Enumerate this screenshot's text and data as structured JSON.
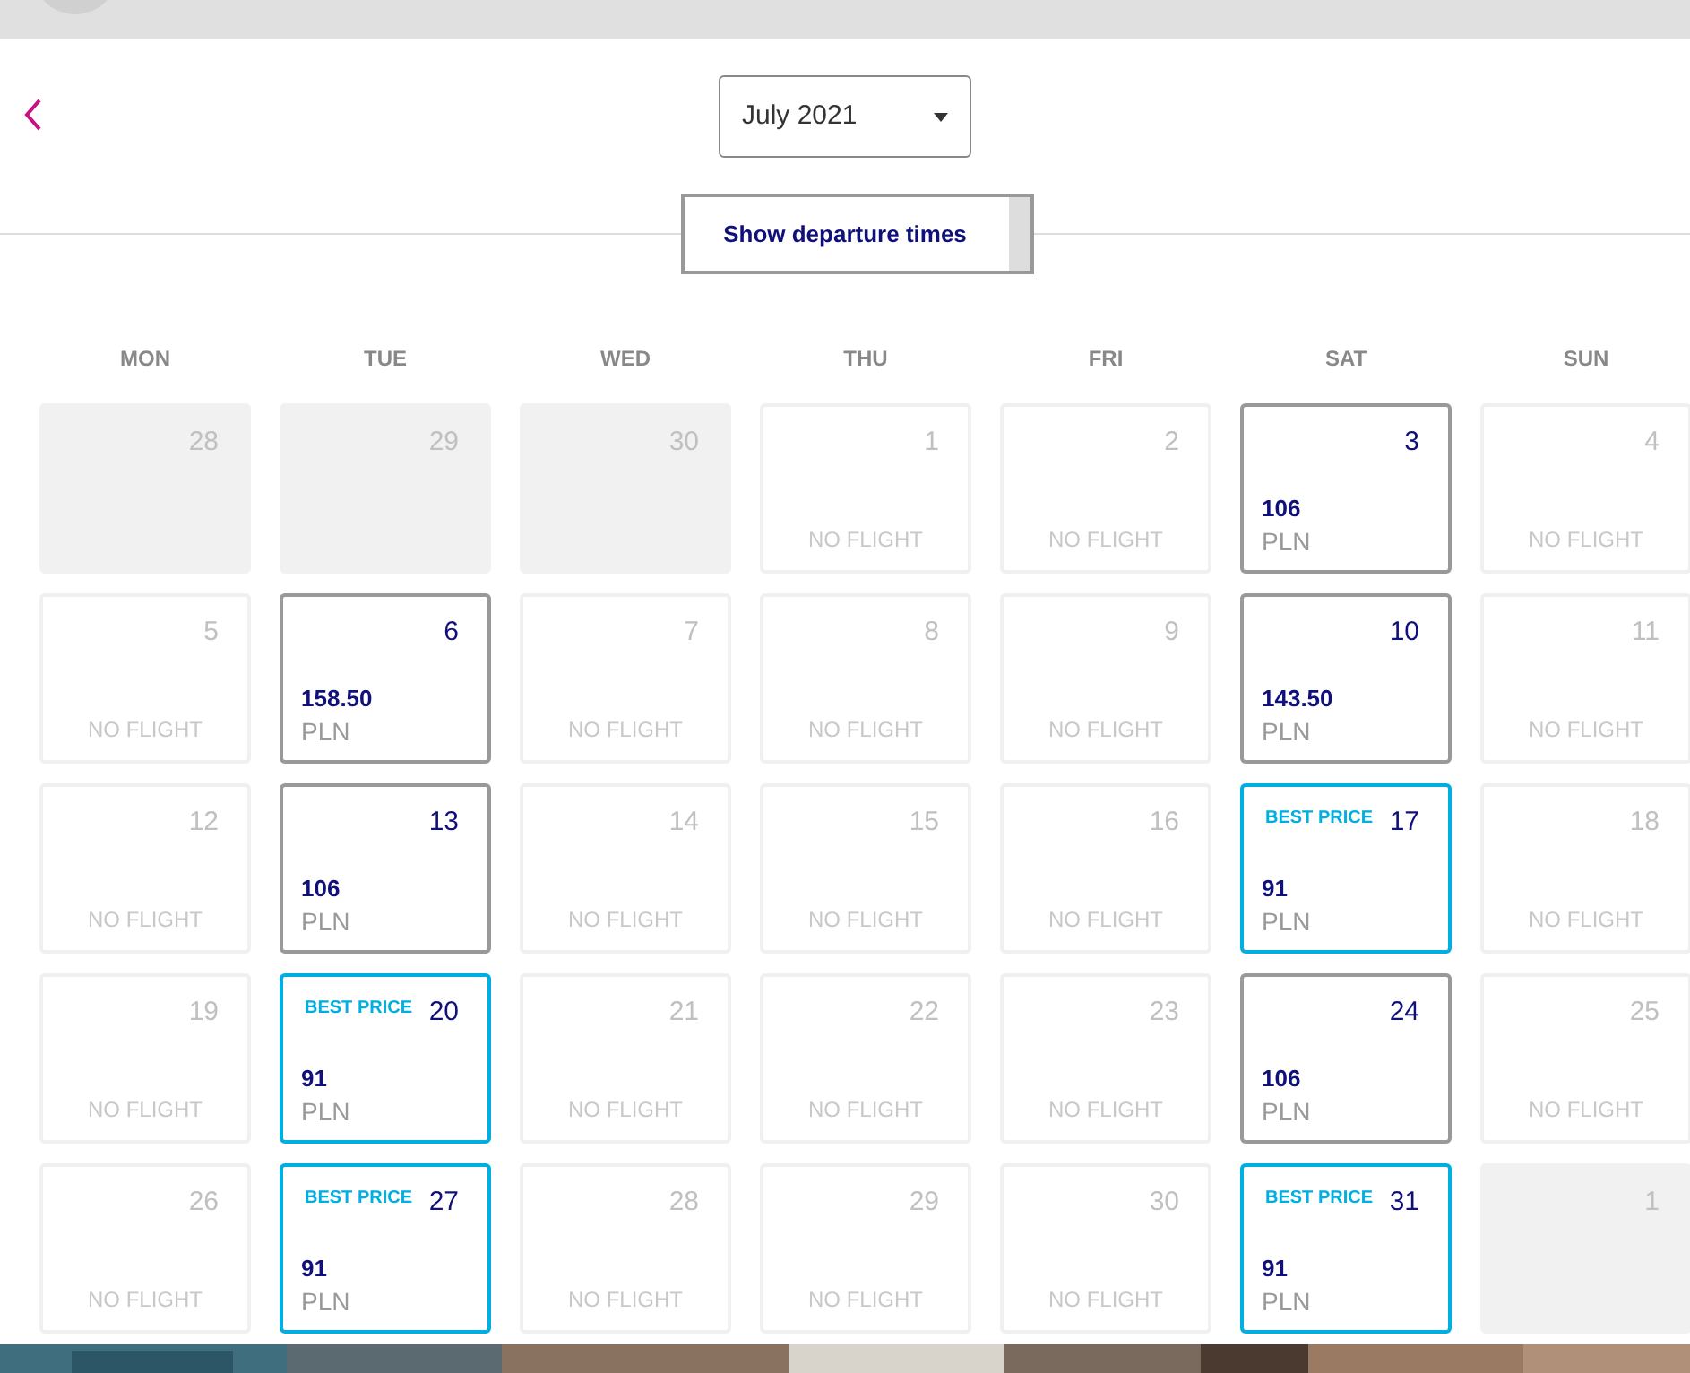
{
  "month_select": {
    "value": "July 2021"
  },
  "departure_button": {
    "label": "Show departure times"
  },
  "weekdays": [
    "MON",
    "TUE",
    "WED",
    "THU",
    "FRI",
    "SAT",
    "SUN"
  ],
  "days": [
    {
      "kind": "other_month",
      "day": "28"
    },
    {
      "kind": "other_month",
      "day": "29"
    },
    {
      "kind": "other_month",
      "day": "30"
    },
    {
      "kind": "no_flight",
      "day": "1",
      "note": "NO FLIGHT"
    },
    {
      "kind": "no_flight",
      "day": "2",
      "note": "NO FLIGHT"
    },
    {
      "kind": "flight",
      "day": "3",
      "price": "106",
      "currency": "PLN"
    },
    {
      "kind": "no_flight",
      "day": "4",
      "note": "NO FLIGHT"
    },
    {
      "kind": "no_flight",
      "day": "5",
      "note": "NO FLIGHT"
    },
    {
      "kind": "flight",
      "day": "6",
      "price": "158.50",
      "currency": "PLN"
    },
    {
      "kind": "no_flight",
      "day": "7",
      "note": "NO FLIGHT"
    },
    {
      "kind": "no_flight",
      "day": "8",
      "note": "NO FLIGHT"
    },
    {
      "kind": "no_flight",
      "day": "9",
      "note": "NO FLIGHT"
    },
    {
      "kind": "flight",
      "day": "10",
      "price": "143.50",
      "currency": "PLN"
    },
    {
      "kind": "no_flight",
      "day": "11",
      "note": "NO FLIGHT"
    },
    {
      "kind": "no_flight",
      "day": "12",
      "note": "NO FLIGHT"
    },
    {
      "kind": "flight",
      "day": "13",
      "price": "106",
      "currency": "PLN"
    },
    {
      "kind": "no_flight",
      "day": "14",
      "note": "NO FLIGHT"
    },
    {
      "kind": "no_flight",
      "day": "15",
      "note": "NO FLIGHT"
    },
    {
      "kind": "no_flight",
      "day": "16",
      "note": "NO FLIGHT"
    },
    {
      "kind": "best_price",
      "day": "17",
      "badge": "BEST PRICE",
      "price": "91",
      "currency": "PLN"
    },
    {
      "kind": "no_flight",
      "day": "18",
      "note": "NO FLIGHT"
    },
    {
      "kind": "no_flight",
      "day": "19",
      "note": "NO FLIGHT"
    },
    {
      "kind": "best_price",
      "day": "20",
      "badge": "BEST PRICE",
      "price": "91",
      "currency": "PLN"
    },
    {
      "kind": "no_flight",
      "day": "21",
      "note": "NO FLIGHT"
    },
    {
      "kind": "no_flight",
      "day": "22",
      "note": "NO FLIGHT"
    },
    {
      "kind": "no_flight",
      "day": "23",
      "note": "NO FLIGHT"
    },
    {
      "kind": "flight",
      "day": "24",
      "price": "106",
      "currency": "PLN"
    },
    {
      "kind": "no_flight",
      "day": "25",
      "note": "NO FLIGHT"
    },
    {
      "kind": "no_flight",
      "day": "26",
      "note": "NO FLIGHT"
    },
    {
      "kind": "best_price",
      "day": "27",
      "badge": "BEST PRICE",
      "price": "91",
      "currency": "PLN"
    },
    {
      "kind": "no_flight",
      "day": "28",
      "note": "NO FLIGHT"
    },
    {
      "kind": "no_flight",
      "day": "29",
      "note": "NO FLIGHT"
    },
    {
      "kind": "no_flight",
      "day": "30",
      "note": "NO FLIGHT"
    },
    {
      "kind": "best_price",
      "day": "31",
      "badge": "BEST PRICE",
      "price": "91",
      "currency": "PLN"
    },
    {
      "kind": "other_month",
      "day": "1"
    }
  ]
}
